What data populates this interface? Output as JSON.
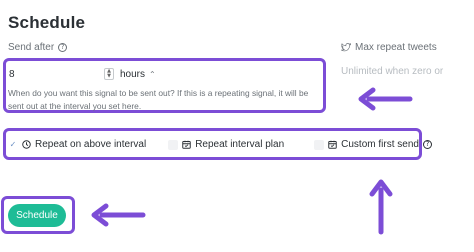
{
  "header": {
    "title": "Schedule"
  },
  "send_after": {
    "label": "Send after",
    "value": "8",
    "unit": "hours",
    "hint": "When do you want this signal to be sent out? If this is a repeating signal, it will be sent out at the interval you set here."
  },
  "max_repeat": {
    "label": "Max repeat tweets",
    "placeholder": "Unlimited when zero or"
  },
  "options": [
    {
      "label": "Repeat on above interval",
      "checked": true
    },
    {
      "label": "Repeat interval plan",
      "checked": false
    },
    {
      "label": "Custom first send",
      "checked": false
    }
  ],
  "actions": {
    "schedule_label": "Schedule"
  },
  "icons": {
    "help": "question-circle-icon",
    "twitter": "twitter-bird-icon",
    "clock": "clock-icon",
    "calendar": "calendar-icon",
    "stepper": "number-stepper-icon",
    "caret": "caret-up-icon"
  },
  "colors": {
    "annotation": "#7c4dd6",
    "primary_button": "#1ebc96",
    "text": "#2b3035",
    "muted": "#6b7177"
  }
}
